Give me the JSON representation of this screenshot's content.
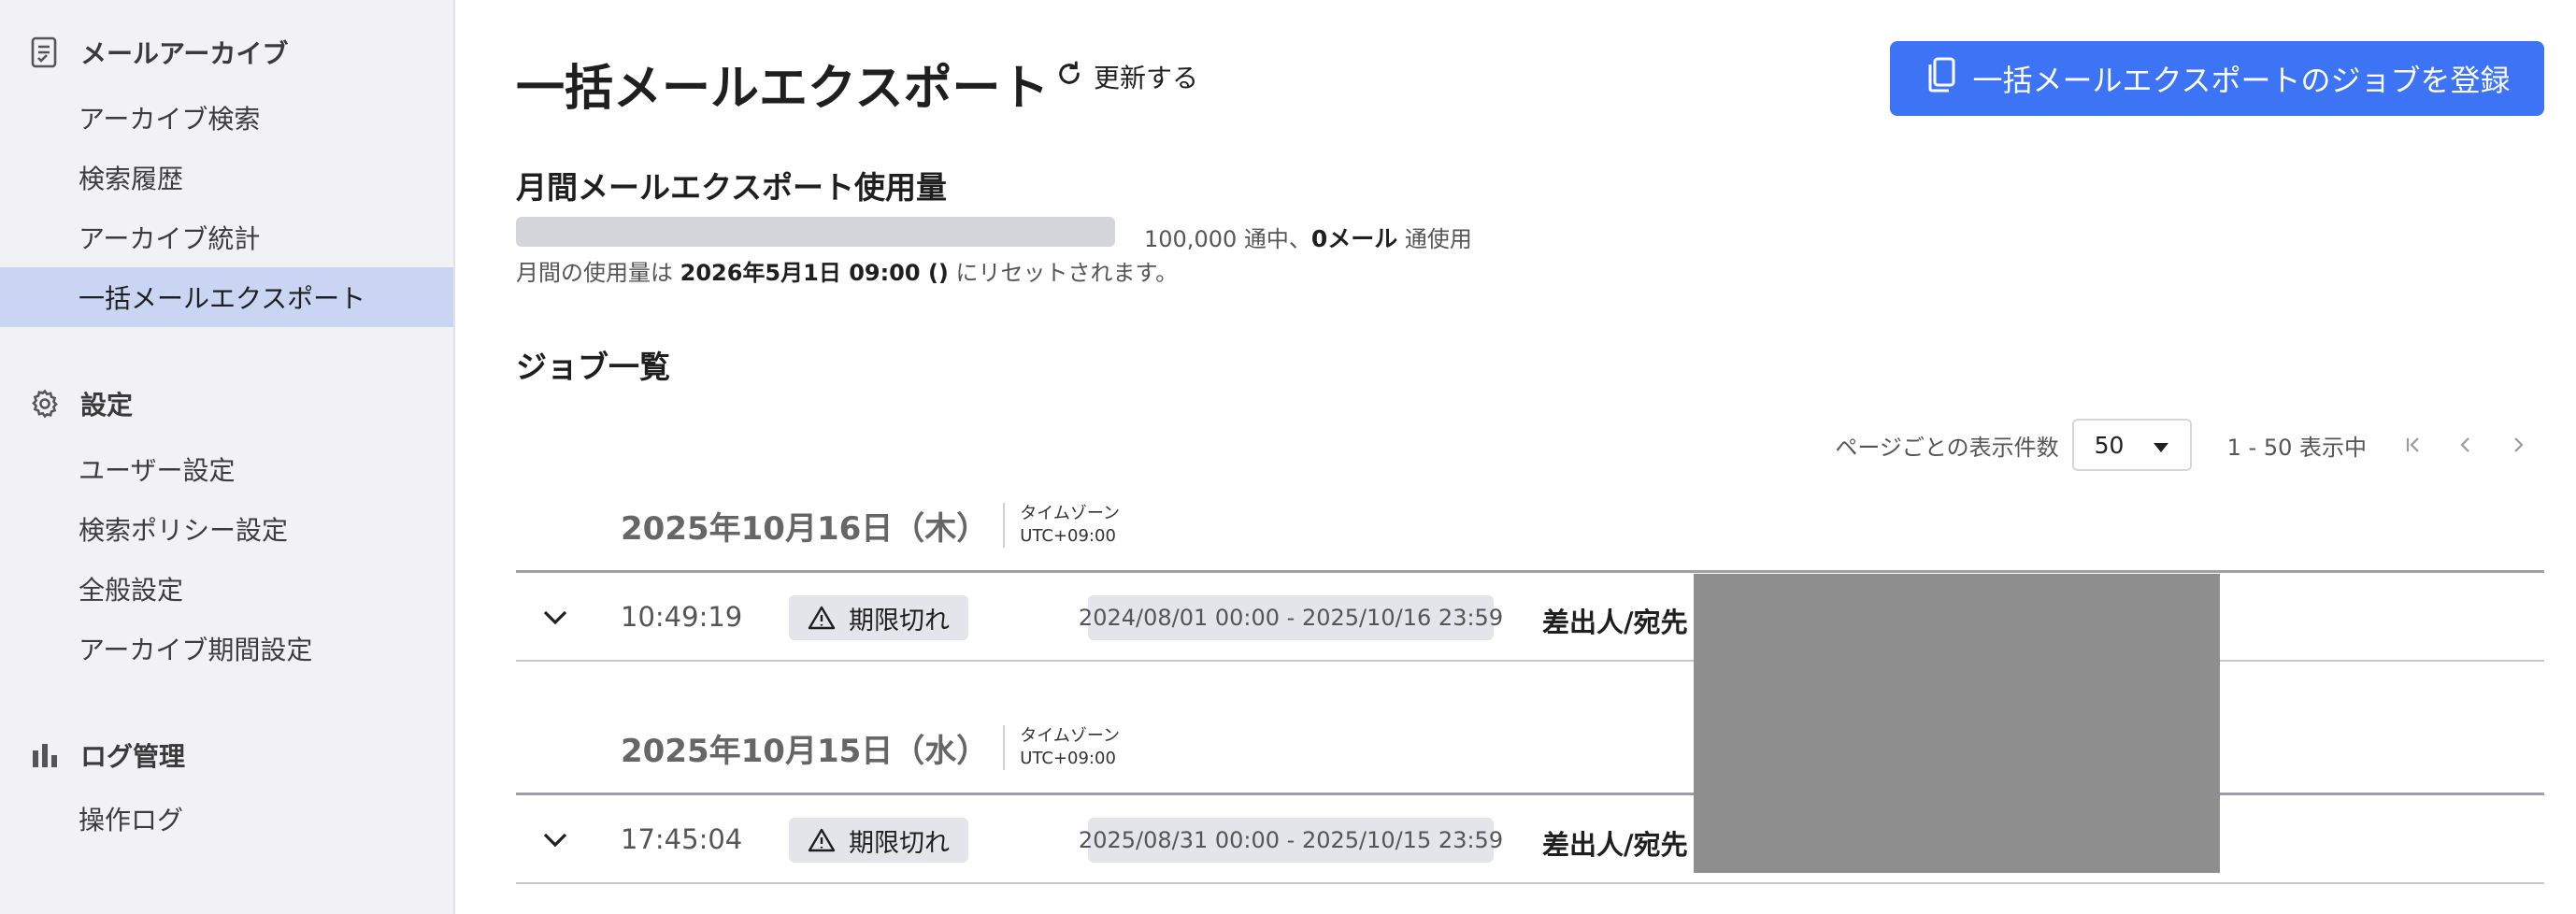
{
  "sidebar": {
    "sections": [
      {
        "icon": "archive-list-icon",
        "label": "メールアーカイブ",
        "items": [
          {
            "label": "アーカイブ検索",
            "active": false
          },
          {
            "label": "検索履歴",
            "active": false
          },
          {
            "label": "アーカイブ統計",
            "active": false
          },
          {
            "label": "一括メールエクスポート",
            "active": true
          }
        ]
      },
      {
        "icon": "gear-icon",
        "label": "設定",
        "items": [
          {
            "label": "ユーザー設定",
            "active": false
          },
          {
            "label": "検索ポリシー設定",
            "active": false
          },
          {
            "label": "全般設定",
            "active": false
          },
          {
            "label": "アーカイブ期間設定",
            "active": false
          }
        ]
      },
      {
        "icon": "bar-chart-icon",
        "label": "ログ管理",
        "items": [
          {
            "label": "操作ログ",
            "active": false
          }
        ]
      }
    ]
  },
  "header": {
    "title": "一括メールエクスポート",
    "refresh_label": "更新する",
    "register_label": "一括メールエクスポートのジョブを登録"
  },
  "usage": {
    "title": "月間メールエクスポート使用量",
    "total_text": "100,000 通中、",
    "used_text": "0メール",
    "used_suffix": " 通使用",
    "used_fraction": 0,
    "reset_prefix": "月間の使用量は ",
    "reset_date": "2026年5月1日 09:00 ()",
    "reset_suffix": " にリセットされます。"
  },
  "jobs": {
    "title": "ジョブ一覧",
    "pager": {
      "per_page_label": "ページごとの表示件数",
      "per_page_value": "50",
      "range_text": "1 - 50 表示中"
    },
    "groups": [
      {
        "date": "2025年10月16日（木）",
        "tz_label": "タイムゾーン",
        "tz_value": "UTC+09:00",
        "time": "10:49:19",
        "status": "期限切れ",
        "period": "2024/08/01 00:00 - 2025/10/16 23:59",
        "sender_label": "差出人/宛先"
      },
      {
        "date": "2025年10月15日（水）",
        "tz_label": "タイムゾーン",
        "tz_value": "UTC+09:00",
        "time": "17:45:04",
        "status": "期限切れ",
        "period": "2025/08/31 00:00 - 2025/10/15 23:59",
        "sender_label": "差出人/宛先"
      }
    ]
  },
  "colors": {
    "accent": "#3d73f5",
    "sidebar_bg": "#f2f2f5",
    "active_item_bg": "#c9d5f3",
    "badge_bg": "#e4e5ea",
    "redaction": "#8e8e8e"
  }
}
